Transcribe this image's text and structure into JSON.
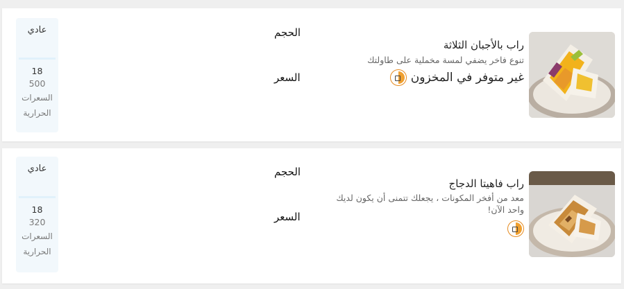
{
  "products": [
    {
      "title": "راب بالأجبان الثلاثة",
      "description": "تنوع فاخر يضفي لمسة مخملية على طاولتك",
      "stock_status": "غير متوفر في المخزون",
      "size_label": "الحجم",
      "price_label": "السعر",
      "size_option": "عادي",
      "price": "18",
      "calories": "500",
      "calories_label_line1": "السعرات",
      "calories_label_line2": "الحرارية",
      "icon": "wrap-icon"
    },
    {
      "title": "راب فاهيتا الدجاج",
      "description": "معد من أفخر المكونات ، يجعلك تتمنى أن يكون لديك واحد الآن!",
      "size_label": "الحجم",
      "price_label": "السعر",
      "size_option": "عادي",
      "price": "18",
      "calories": "320",
      "calories_label_line1": "السعرات",
      "calories_label_line2": "الحرارية",
      "icon": "wrap-icon"
    }
  ],
  "colors": {
    "accent_orange": "#f0a030",
    "side_panel_bg": "#f2f8fc",
    "page_bg": "#efefef"
  }
}
